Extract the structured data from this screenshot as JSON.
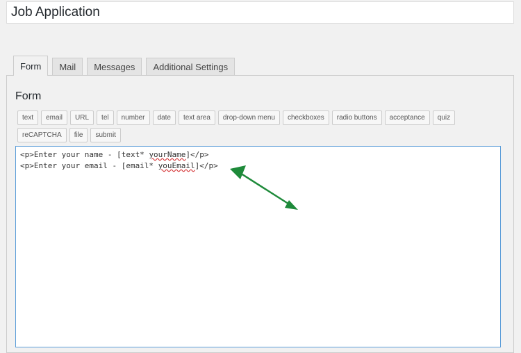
{
  "page": {
    "title": "Job Application"
  },
  "tabs": [
    {
      "label": "Form"
    },
    {
      "label": "Mail"
    },
    {
      "label": "Messages"
    },
    {
      "label": "Additional Settings"
    }
  ],
  "form_section": {
    "title": "Form",
    "tag_buttons": [
      {
        "label": "text"
      },
      {
        "label": "email"
      },
      {
        "label": "URL"
      },
      {
        "label": "tel"
      },
      {
        "label": "number"
      },
      {
        "label": "date"
      },
      {
        "label": "text area"
      },
      {
        "label": "drop-down menu"
      },
      {
        "label": "checkboxes"
      },
      {
        "label": "radio buttons"
      },
      {
        "label": "acceptance"
      },
      {
        "label": "quiz"
      },
      {
        "label": "reCAPTCHA"
      },
      {
        "label": "file"
      },
      {
        "label": "submit"
      }
    ],
    "editor": {
      "line1_pre": "<p>Enter your name - [text* ",
      "line1_word": "yourName",
      "line1_post": "]</p>",
      "line2_pre": "<p>Enter your email - [email* ",
      "line2_word": "youEmail",
      "line2_post": "]</p>"
    }
  },
  "colors": {
    "arrow": "#1e8a3a",
    "editor_focus_border": "#5b9dd9"
  }
}
